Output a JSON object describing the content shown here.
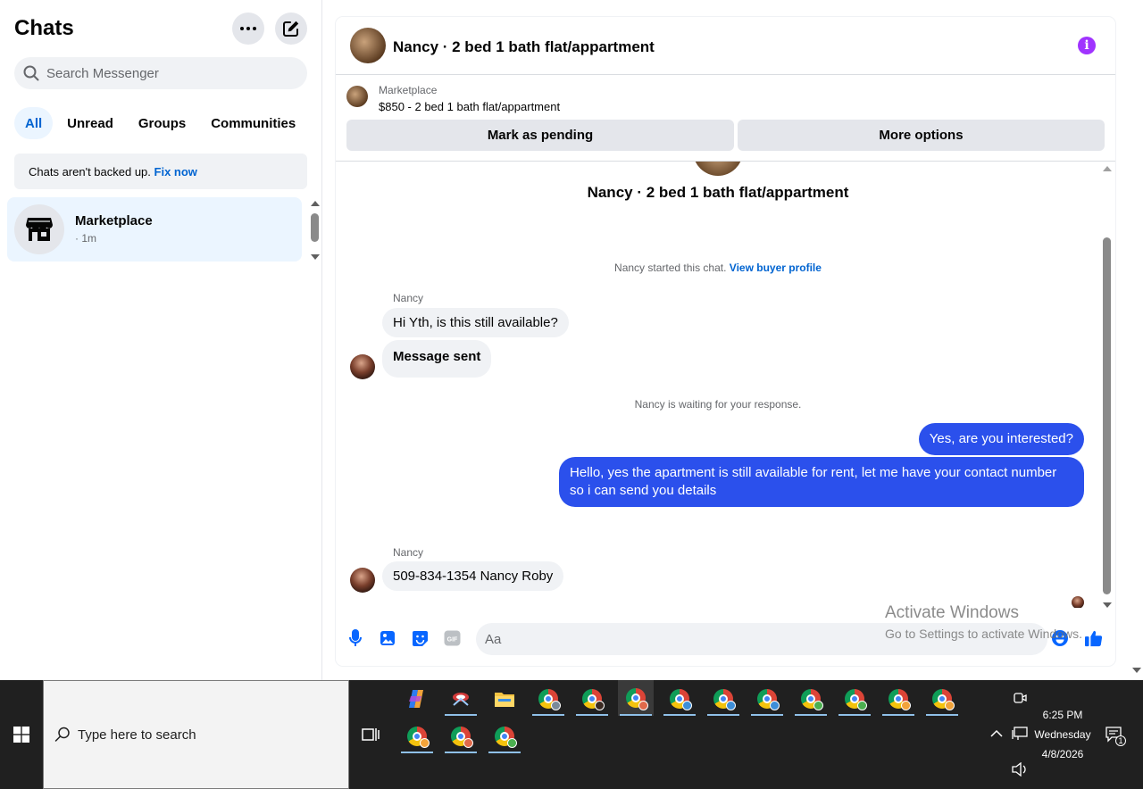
{
  "sidebar": {
    "title": "Chats",
    "search_placeholder": "Search Messenger",
    "filters": [
      "All",
      "Unread",
      "Groups",
      "Communities"
    ],
    "active_filter": "All",
    "backup_notice": "Chats aren't backed up.",
    "backup_link": "Fix now",
    "chats": [
      {
        "name": "Marketplace",
        "time": "· 1m"
      }
    ]
  },
  "conversation": {
    "header_title": "Nancy · 2 bed 1 bath flat/appartment",
    "marketplace_label": "Marketplace",
    "listing": "$850 - 2 bed 1 bath flat/appartment",
    "mark_pending_label": "Mark as pending",
    "more_options_label": "More options",
    "intro_title": "Nancy · 2 bed 1 bath flat/appartment",
    "started_text": "Nancy started this chat.",
    "view_profile_link": "View buyer profile",
    "waiting_text": "Nancy is waiting for your response.",
    "messages": [
      {
        "sender": "Nancy",
        "direction": "in",
        "text": "Hi Yth, is this still available?"
      },
      {
        "sender": "Nancy",
        "direction": "in",
        "text": "Message sent"
      },
      {
        "sender": "",
        "direction": "out",
        "text": "Yes, are you interested?"
      },
      {
        "sender": "",
        "direction": "out",
        "text": "Hello, yes the apartment is still available for rent, let me have your contact number so i can send you details"
      },
      {
        "sender": "Nancy",
        "direction": "in",
        "text": "509-834-1354  Nancy Roby"
      }
    ],
    "composer_placeholder": "Aa"
  },
  "watermark": {
    "line1": "Activate Windows",
    "line2": "Go to Settings to activate Windows."
  },
  "taskbar": {
    "search_placeholder": "Type here to search",
    "time": "6:25 PM",
    "day": "Wednesday",
    "date": "4/8/2026",
    "notification_count": "1"
  },
  "colors": {
    "accent": "#0064d1",
    "outgoing_bubble": "#2b50ec",
    "incoming_bubble": "#f0f2f5",
    "info_icon": "#a033ff"
  }
}
